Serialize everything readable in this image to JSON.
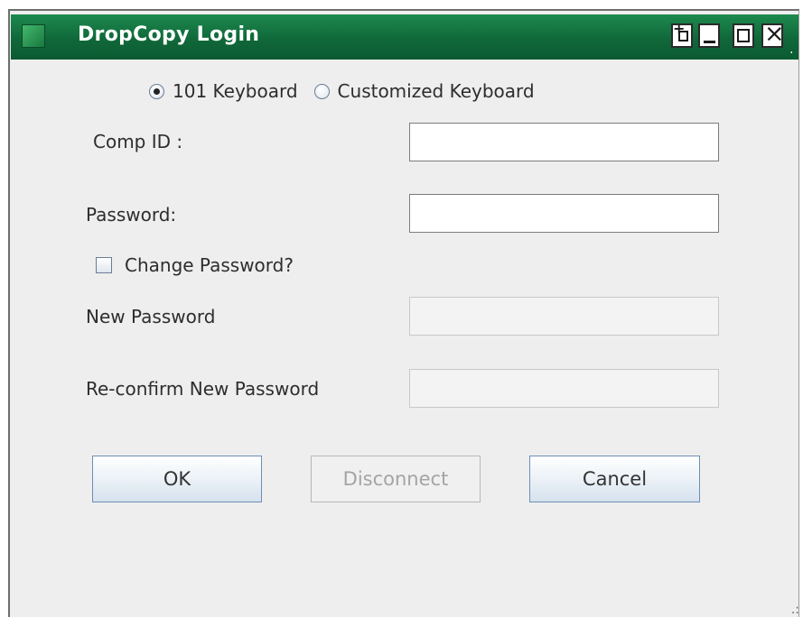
{
  "window": {
    "title": "DropCopy Login"
  },
  "titlebar_buttons": {
    "float": "float-icon",
    "minimize": "minimize-icon",
    "maximize": "maximize-icon",
    "close": "close-icon"
  },
  "keyboard": {
    "options": [
      "101 Keyboard",
      "Customized Keyboard"
    ],
    "selected": "101 Keyboard"
  },
  "form": {
    "comp_id_label": "Comp ID :",
    "comp_id_value": "",
    "password_label": "Password:",
    "password_value": "",
    "change_password_label": "Change Password?",
    "change_password_checked": false,
    "new_password_label": "New Password",
    "new_password_value": "",
    "reconfirm_label": "Re-confirm New Password",
    "reconfirm_value": ""
  },
  "buttons": {
    "ok": "OK",
    "disconnect": "Disconnect",
    "cancel": "Cancel"
  },
  "colors": {
    "titlebar": "#10683a",
    "window_bg": "#eeeeee",
    "button_border": "#6d8eb6"
  }
}
